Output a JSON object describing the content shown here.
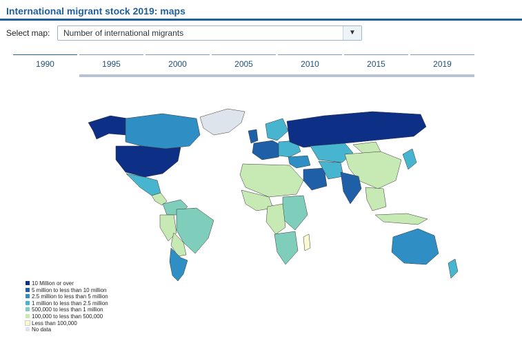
{
  "header": {
    "title": "International migrant stock 2019: maps"
  },
  "select": {
    "label": "Select map:",
    "value": "Number of international migrants",
    "arrow": "▼"
  },
  "tabs": [
    {
      "label": "1990"
    },
    {
      "label": "1995"
    },
    {
      "label": "2000"
    },
    {
      "label": "2005"
    },
    {
      "label": "2010"
    },
    {
      "label": "2015"
    },
    {
      "label": "2019"
    }
  ],
  "legend": [
    {
      "label": "10 Million or over",
      "color": "#0d2f86"
    },
    {
      "label": "5 million to less than 10 million",
      "color": "#1f5fa8"
    },
    {
      "label": "2.5 million to less than 5 million",
      "color": "#2f8ec3"
    },
    {
      "label": "1 million to less than 2.5 million",
      "color": "#47b5cf"
    },
    {
      "label": "500,000 to less than 1 million",
      "color": "#7fcdbb"
    },
    {
      "label": "100,000 to less than 500,000",
      "color": "#c7e9b4"
    },
    {
      "label": "Less than 100,000",
      "color": "#fafad2"
    },
    {
      "label": "No data",
      "color": "#dde4ec"
    }
  ]
}
